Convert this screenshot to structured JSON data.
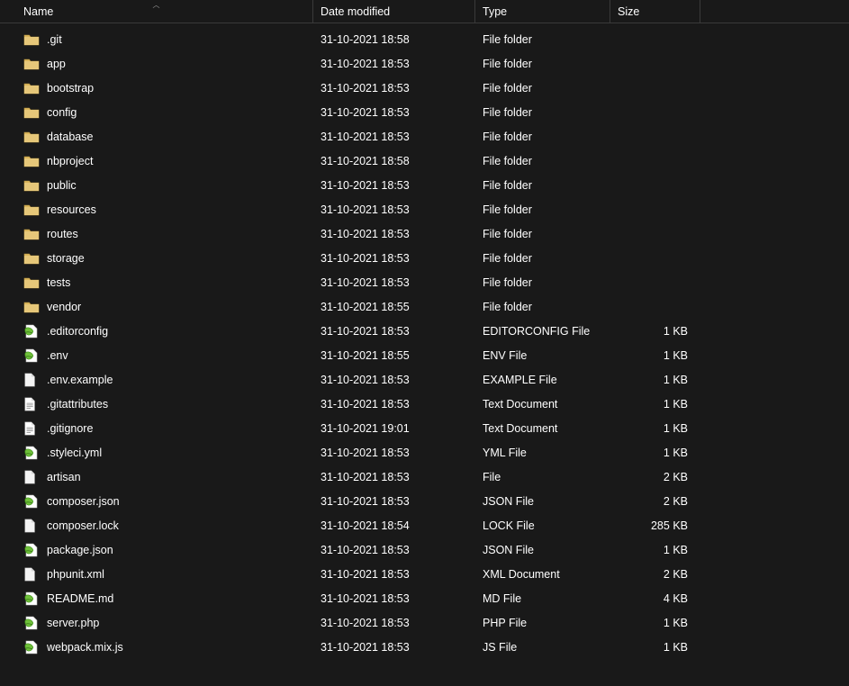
{
  "columns": {
    "name": {
      "label": "Name",
      "sorted": "asc"
    },
    "date": {
      "label": "Date modified"
    },
    "type": {
      "label": "Type"
    },
    "size": {
      "label": "Size"
    }
  },
  "items": [
    {
      "icon": "folder",
      "name": ".git",
      "date": "31-10-2021 18:58",
      "type": "File folder",
      "size": ""
    },
    {
      "icon": "folder",
      "name": "app",
      "date": "31-10-2021 18:53",
      "type": "File folder",
      "size": ""
    },
    {
      "icon": "folder",
      "name": "bootstrap",
      "date": "31-10-2021 18:53",
      "type": "File folder",
      "size": ""
    },
    {
      "icon": "folder",
      "name": "config",
      "date": "31-10-2021 18:53",
      "type": "File folder",
      "size": ""
    },
    {
      "icon": "folder",
      "name": "database",
      "date": "31-10-2021 18:53",
      "type": "File folder",
      "size": ""
    },
    {
      "icon": "folder",
      "name": "nbproject",
      "date": "31-10-2021 18:58",
      "type": "File folder",
      "size": ""
    },
    {
      "icon": "folder",
      "name": "public",
      "date": "31-10-2021 18:53",
      "type": "File folder",
      "size": ""
    },
    {
      "icon": "folder",
      "name": "resources",
      "date": "31-10-2021 18:53",
      "type": "File folder",
      "size": ""
    },
    {
      "icon": "folder",
      "name": "routes",
      "date": "31-10-2021 18:53",
      "type": "File folder",
      "size": ""
    },
    {
      "icon": "folder",
      "name": "storage",
      "date": "31-10-2021 18:53",
      "type": "File folder",
      "size": ""
    },
    {
      "icon": "folder",
      "name": "tests",
      "date": "31-10-2021 18:53",
      "type": "File folder",
      "size": ""
    },
    {
      "icon": "folder",
      "name": "vendor",
      "date": "31-10-2021 18:55",
      "type": "File folder",
      "size": ""
    },
    {
      "icon": "code",
      "name": ".editorconfig",
      "date": "31-10-2021 18:53",
      "type": "EDITORCONFIG File",
      "size": "1 KB"
    },
    {
      "icon": "code",
      "name": ".env",
      "date": "31-10-2021 18:55",
      "type": "ENV File",
      "size": "1 KB"
    },
    {
      "icon": "file",
      "name": ".env.example",
      "date": "31-10-2021 18:53",
      "type": "EXAMPLE File",
      "size": "1 KB"
    },
    {
      "icon": "text",
      "name": ".gitattributes",
      "date": "31-10-2021 18:53",
      "type": "Text Document",
      "size": "1 KB"
    },
    {
      "icon": "text",
      "name": ".gitignore",
      "date": "31-10-2021 19:01",
      "type": "Text Document",
      "size": "1 KB"
    },
    {
      "icon": "code",
      "name": ".styleci.yml",
      "date": "31-10-2021 18:53",
      "type": "YML File",
      "size": "1 KB"
    },
    {
      "icon": "file",
      "name": "artisan",
      "date": "31-10-2021 18:53",
      "type": "File",
      "size": "2 KB"
    },
    {
      "icon": "code",
      "name": "composer.json",
      "date": "31-10-2021 18:53",
      "type": "JSON File",
      "size": "2 KB"
    },
    {
      "icon": "file",
      "name": "composer.lock",
      "date": "31-10-2021 18:54",
      "type": "LOCK File",
      "size": "285 KB"
    },
    {
      "icon": "code",
      "name": "package.json",
      "date": "31-10-2021 18:53",
      "type": "JSON File",
      "size": "1 KB"
    },
    {
      "icon": "file",
      "name": "phpunit.xml",
      "date": "31-10-2021 18:53",
      "type": "XML Document",
      "size": "2 KB"
    },
    {
      "icon": "code",
      "name": "README.md",
      "date": "31-10-2021 18:53",
      "type": "MD File",
      "size": "4 KB"
    },
    {
      "icon": "code",
      "name": "server.php",
      "date": "31-10-2021 18:53",
      "type": "PHP File",
      "size": "1 KB"
    },
    {
      "icon": "code",
      "name": "webpack.mix.js",
      "date": "31-10-2021 18:53",
      "type": "JS File",
      "size": "1 KB"
    }
  ]
}
